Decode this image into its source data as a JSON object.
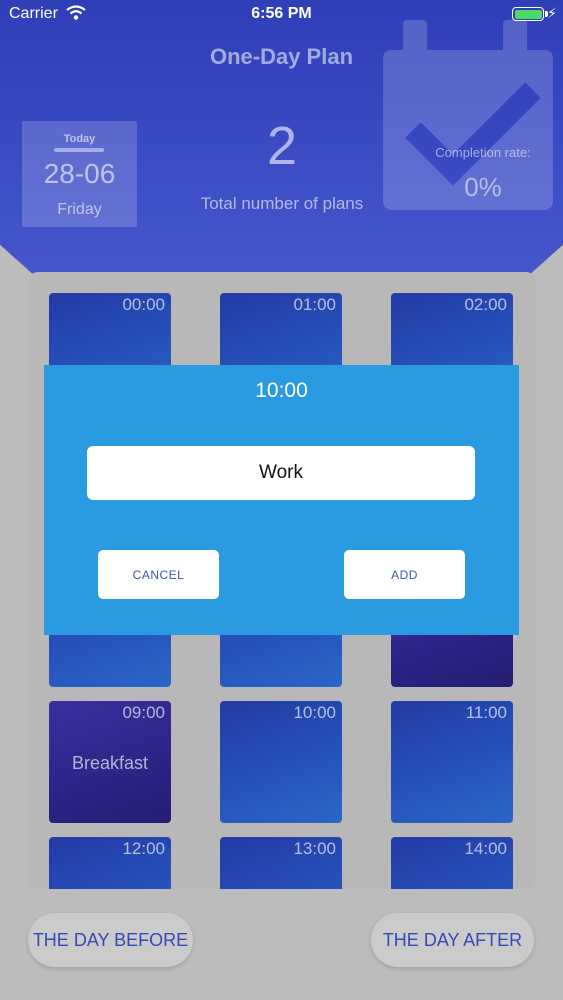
{
  "status_bar": {
    "carrier": "Carrier",
    "time": "6:56 PM",
    "battery_icon": "battery-charging-icon",
    "wifi_icon": "wifi-icon"
  },
  "header": {
    "title": "One-Day Plan",
    "today_label": "Today",
    "date": "28-06",
    "weekday": "Friday",
    "total_plans": "2",
    "total_label": "Total number of plans",
    "completion_label": "Completion rate:",
    "completion_value": "0%"
  },
  "grid": {
    "slots": [
      {
        "time": "00:00",
        "plan": ""
      },
      {
        "time": "01:00",
        "plan": ""
      },
      {
        "time": "02:00",
        "plan": ""
      },
      {
        "time": "",
        "plan": ""
      },
      {
        "time": "",
        "plan": ""
      },
      {
        "time": "",
        "plan": ""
      },
      {
        "time": "09:00",
        "plan": "Breakfast"
      },
      {
        "time": "10:00",
        "plan": ""
      },
      {
        "time": "11:00",
        "plan": ""
      },
      {
        "time": "12:00",
        "plan": ""
      },
      {
        "time": "13:00",
        "plan": ""
      },
      {
        "time": "14:00",
        "plan": ""
      }
    ]
  },
  "dialog": {
    "title": "10:00",
    "input_value": "Work",
    "cancel_label": "CANCEL",
    "add_label": "ADD"
  },
  "footer": {
    "day_before": "THE DAY BEFORE",
    "day_after": "THE DAY AFTER"
  },
  "colors": {
    "header": "#3a4bc4",
    "dialog": "#2a9be0",
    "slot": "#2650b8",
    "slot_planned": "#2d2588",
    "button_text": "#3449b6"
  }
}
